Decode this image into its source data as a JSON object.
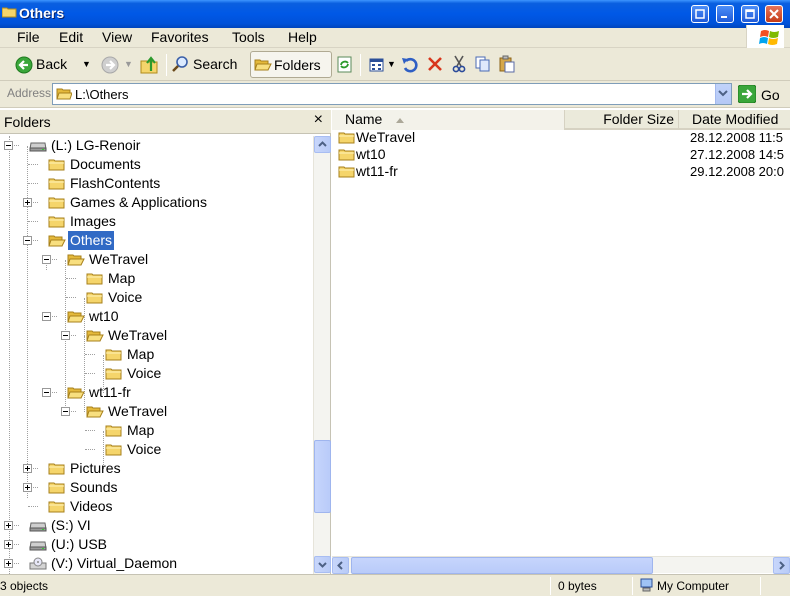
{
  "window": {
    "title": "Others"
  },
  "menu": [
    "File",
    "Edit",
    "View",
    "Favorites",
    "Tools",
    "Help"
  ],
  "toolbar": {
    "back": "Back",
    "search": "Search",
    "folders": "Folders"
  },
  "address": {
    "label": "Address",
    "value": "L:\\Others",
    "go": "Go"
  },
  "folders_pane": {
    "title": "Folders",
    "close": "×",
    "tree": [
      {
        "label": "(L:) LG-Renoir",
        "icon": "drive-icon"
      },
      {
        "label": "Documents",
        "icon": "folder-icon"
      },
      {
        "label": "FlashContents",
        "icon": "folder-icon"
      },
      {
        "label": "Games & Applications",
        "icon": "folder-icon"
      },
      {
        "label": "Images",
        "icon": "folder-icon"
      },
      {
        "label": "Others",
        "icon": "folder-open-icon",
        "selected": true
      },
      {
        "label": "WeTravel",
        "icon": "folder-open-icon"
      },
      {
        "label": "Map",
        "icon": "folder-icon"
      },
      {
        "label": "Voice",
        "icon": "folder-icon"
      },
      {
        "label": "wt10",
        "icon": "folder-open-icon"
      },
      {
        "label": "WeTravel",
        "icon": "folder-open-icon"
      },
      {
        "label": "Map",
        "icon": "folder-icon"
      },
      {
        "label": "Voice",
        "icon": "folder-icon"
      },
      {
        "label": "wt11-fr",
        "icon": "folder-open-icon"
      },
      {
        "label": "WeTravel",
        "icon": "folder-open-icon"
      },
      {
        "label": "Map",
        "icon": "folder-icon"
      },
      {
        "label": "Voice",
        "icon": "folder-icon"
      },
      {
        "label": "Pictures",
        "icon": "folder-icon"
      },
      {
        "label": "Sounds",
        "icon": "folder-icon"
      },
      {
        "label": "Videos",
        "icon": "folder-icon"
      },
      {
        "label": "(S:) VI",
        "icon": "drive-icon"
      },
      {
        "label": "(U:) USB",
        "icon": "drive-icon"
      },
      {
        "label": "(V:) Virtual_Daemon",
        "icon": "cd-drive-icon"
      }
    ]
  },
  "list": {
    "columns": [
      "Name",
      "Folder Size",
      "Date Modified"
    ],
    "rows": [
      {
        "name": "WeTravel",
        "date": "28.12.2008 11:5"
      },
      {
        "name": "wt10",
        "date": "27.12.2008 14:5"
      },
      {
        "name": "wt11-fr",
        "date": "29.12.2008 20:0"
      }
    ]
  },
  "status": {
    "objects": "3 objects",
    "size": "0 bytes",
    "location": "My Computer"
  },
  "colors": {
    "titlebar": "#0058e6",
    "chrome": "#ece9d8",
    "selection": "#316ac5",
    "folder": "#f5d56b"
  }
}
